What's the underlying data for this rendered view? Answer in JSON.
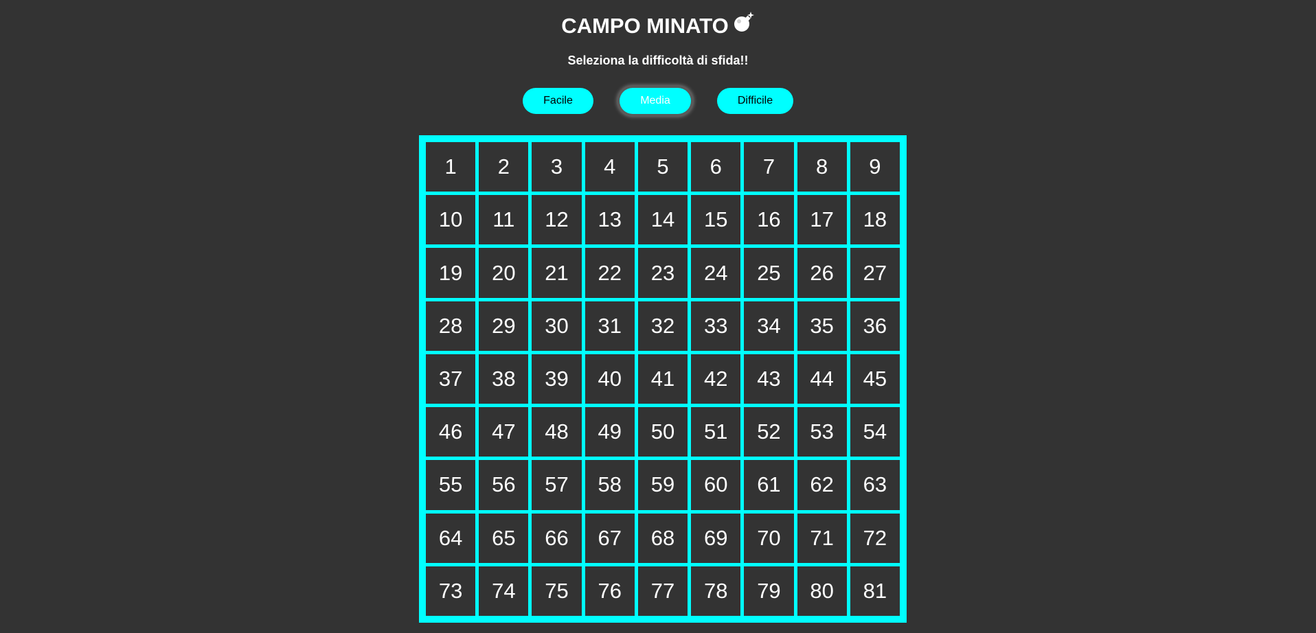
{
  "header": {
    "title": "CAMPO MINATO",
    "title_icon": "bomb-icon",
    "subtitle": "Seleziona la difficoltà di sfida!!"
  },
  "difficulty": {
    "selected": "Media",
    "buttons": [
      {
        "label": "Facile"
      },
      {
        "label": "Media"
      },
      {
        "label": "Difficile"
      }
    ]
  },
  "board": {
    "rows": 9,
    "columns": 9,
    "cells": [
      "1",
      "2",
      "3",
      "4",
      "5",
      "6",
      "7",
      "8",
      "9",
      "10",
      "11",
      "12",
      "13",
      "14",
      "15",
      "16",
      "17",
      "18",
      "19",
      "20",
      "21",
      "22",
      "23",
      "24",
      "25",
      "26",
      "27",
      "28",
      "29",
      "30",
      "31",
      "32",
      "33",
      "34",
      "35",
      "36",
      "37",
      "38",
      "39",
      "40",
      "41",
      "42",
      "43",
      "44",
      "45",
      "46",
      "47",
      "48",
      "49",
      "50",
      "51",
      "52",
      "53",
      "54",
      "55",
      "56",
      "57",
      "58",
      "59",
      "60",
      "61",
      "62",
      "63",
      "64",
      "65",
      "66",
      "67",
      "68",
      "69",
      "70",
      "71",
      "72",
      "73",
      "74",
      "75",
      "76",
      "77",
      "78",
      "79",
      "80",
      "81"
    ]
  },
  "colors": {
    "background": "#333333",
    "accent": "#00ffff",
    "text": "#ffffff"
  }
}
